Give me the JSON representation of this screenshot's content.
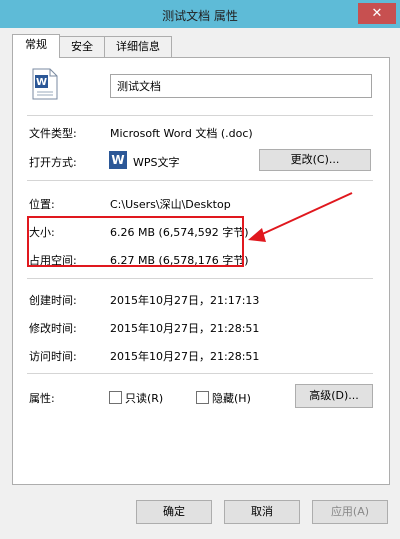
{
  "window": {
    "title": "测试文档 属性",
    "close_glyph": "✕"
  },
  "tabs": [
    {
      "label": "常规"
    },
    {
      "label": "安全"
    },
    {
      "label": "详细信息"
    }
  ],
  "general": {
    "file_name": "测试文档",
    "file_type_label": "文件类型:",
    "file_type_value": "Microsoft Word 文档 (.doc)",
    "open_with_label": "打开方式:",
    "open_with_app": "WPS文字",
    "change_button": "更改(C)...",
    "location_label": "位置:",
    "location_value": "C:\\Users\\深山\\Desktop",
    "size_label": "大小:",
    "size_value": "6.26 MB (6,574,592 字节)",
    "size_on_disk_label": "占用空间:",
    "size_on_disk_value": "6.27 MB (6,578,176 字节)",
    "created_label": "创建时间:",
    "created_value": "2015年10月27日，21:17:13",
    "modified_label": "修改时间:",
    "modified_value": "2015年10月27日，21:28:51",
    "accessed_label": "访问时间:",
    "accessed_value": "2015年10月27日，21:28:51",
    "attributes_label": "属性:",
    "readonly_label": "只读(R)",
    "hidden_label": "隐藏(H)",
    "advanced_button": "高级(D)..."
  },
  "footer": {
    "ok": "确定",
    "cancel": "取消",
    "apply": "应用(A)"
  },
  "colors": {
    "titlebar": "#5ebbd7",
    "highlight": "#e0181e",
    "word_icon": "#2b5797"
  }
}
